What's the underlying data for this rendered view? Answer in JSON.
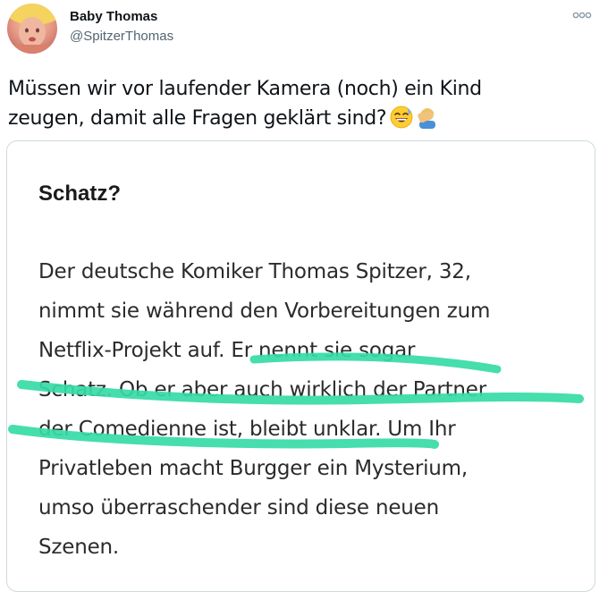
{
  "author": {
    "display_name": "Baby Thomas",
    "handle": "@SpitzerThomas",
    "avatar_icon": "profile-photo"
  },
  "menu": {
    "more_icon": "ellipsis-icon"
  },
  "tweet": {
    "text_line1": "Müssen wir vor laufender Kamera (noch) ein Kind",
    "text_line2": "zeugen, damit alle Fragen geklärt sind?",
    "emoji_1": "grinning-face-with-sweat-icon",
    "emoji_2": "person-facepalming-icon"
  },
  "card": {
    "title": "Schatz?",
    "body_lines": [
      "Der deutsche Komiker Thomas Spitzer, 32,",
      "nimmt sie während den Vorbereitungen zum",
      "Netflix-Projekt auf. Er nennt sie sogar",
      "Schatz. Ob er aber auch wirklich der Partner",
      "der Comedienne ist, bleibt unklar. Um Ihr",
      "Privatleben macht Burgger ein Mysterium,",
      "umso überraschender sind diese neuen",
      "Szenen."
    ],
    "highlight_color": "#35dba5"
  }
}
